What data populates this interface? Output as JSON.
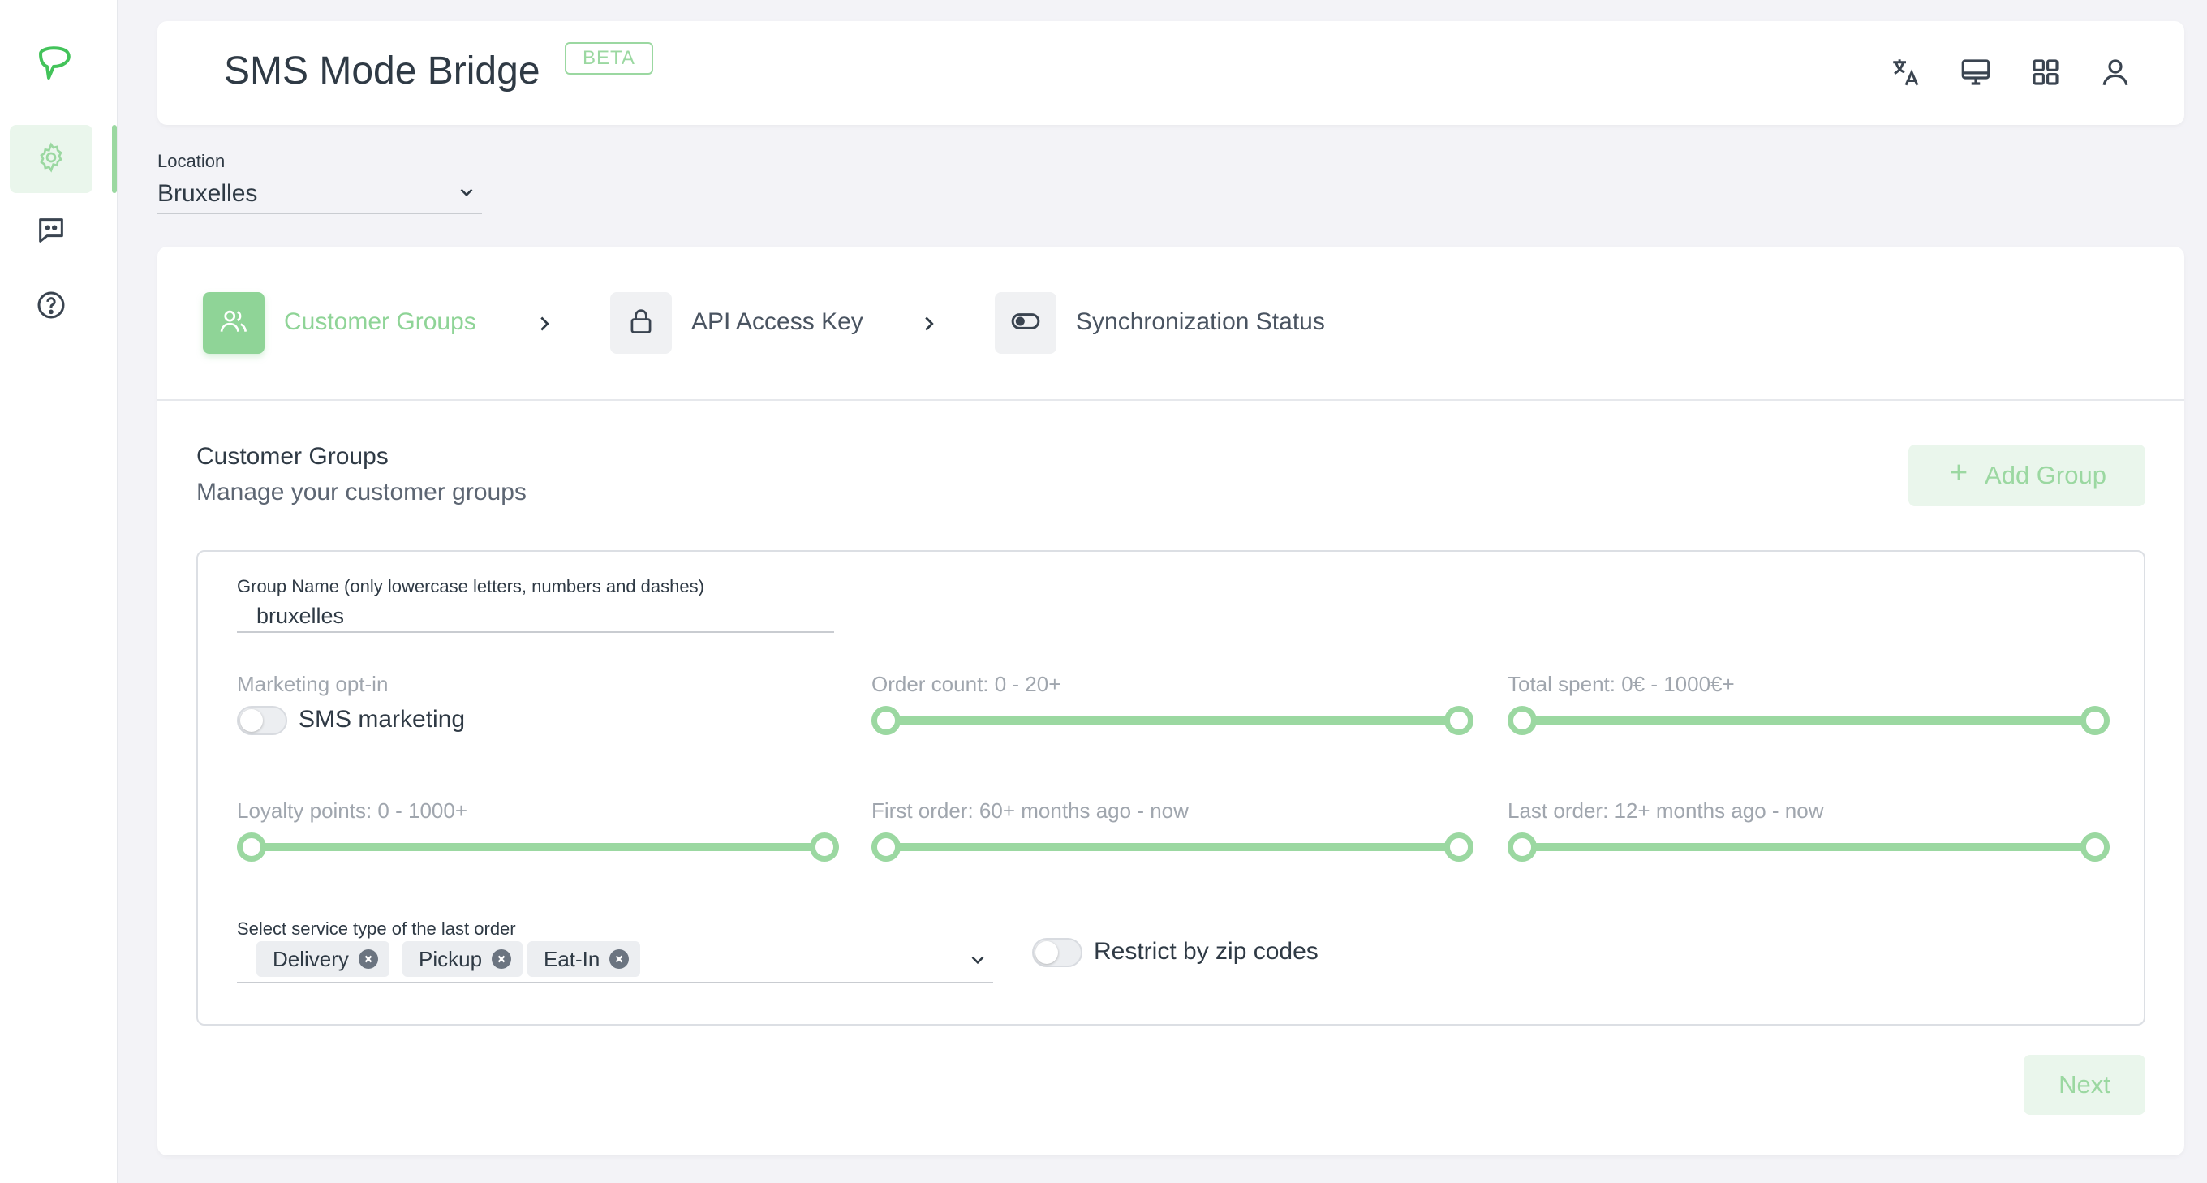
{
  "app": {
    "title": "SMS Mode Bridge",
    "badge": "BETA"
  },
  "sidebar": {
    "items": [
      {
        "name": "settings",
        "active": true
      },
      {
        "name": "messages",
        "active": false
      },
      {
        "name": "help",
        "active": false
      }
    ]
  },
  "topbar_icons": [
    "translate-icon",
    "monitor-icon",
    "apps-grid-icon",
    "user-icon"
  ],
  "location": {
    "label": "Location",
    "value": "Bruxelles"
  },
  "steps": [
    {
      "label": "Customer Groups",
      "icon": "users-icon",
      "active": true
    },
    {
      "label": "API Access Key",
      "icon": "lock-icon",
      "active": false
    },
    {
      "label": "Synchronization Status",
      "icon": "toggle-icon",
      "active": false
    }
  ],
  "section": {
    "title": "Customer Groups",
    "subtitle": "Manage your customer groups",
    "add_button": "Add Group"
  },
  "group": {
    "name_label": "Group Name (only lowercase letters, numbers and dashes)",
    "name_value": "bruxelles",
    "marketing_label": "Marketing opt-in",
    "sms_toggle_label": "SMS marketing",
    "sms_toggle_on": false,
    "order_count_label": "Order count: 0 - 20+",
    "total_spent_label": "Total spent: 0€ - 1000€+",
    "loyalty_label": "Loyalty points: 0 - 1000+",
    "first_order_label": "First order: 60+ months ago - now",
    "last_order_label": "Last order: 12+ months ago - now",
    "sliders": {
      "order_count": {
        "min": 0,
        "max": 1
      },
      "total_spent": {
        "min": 0,
        "max": 1
      },
      "loyalty": {
        "min": 0,
        "max": 1
      },
      "first_order": {
        "min": 0,
        "max": 1
      },
      "last_order": {
        "min": 0,
        "max": 1
      }
    },
    "service_label": "Select service type of the last order",
    "service_chips": [
      "Delivery",
      "Pickup",
      "Eat-In"
    ],
    "zip_toggle_label": "Restrict by zip codes",
    "zip_toggle_on": false
  },
  "next_button": "Next",
  "colors": {
    "accent": "#9bd8a1",
    "accent_strong": "#8fd497",
    "accent_bg": "#eaf6ec"
  }
}
